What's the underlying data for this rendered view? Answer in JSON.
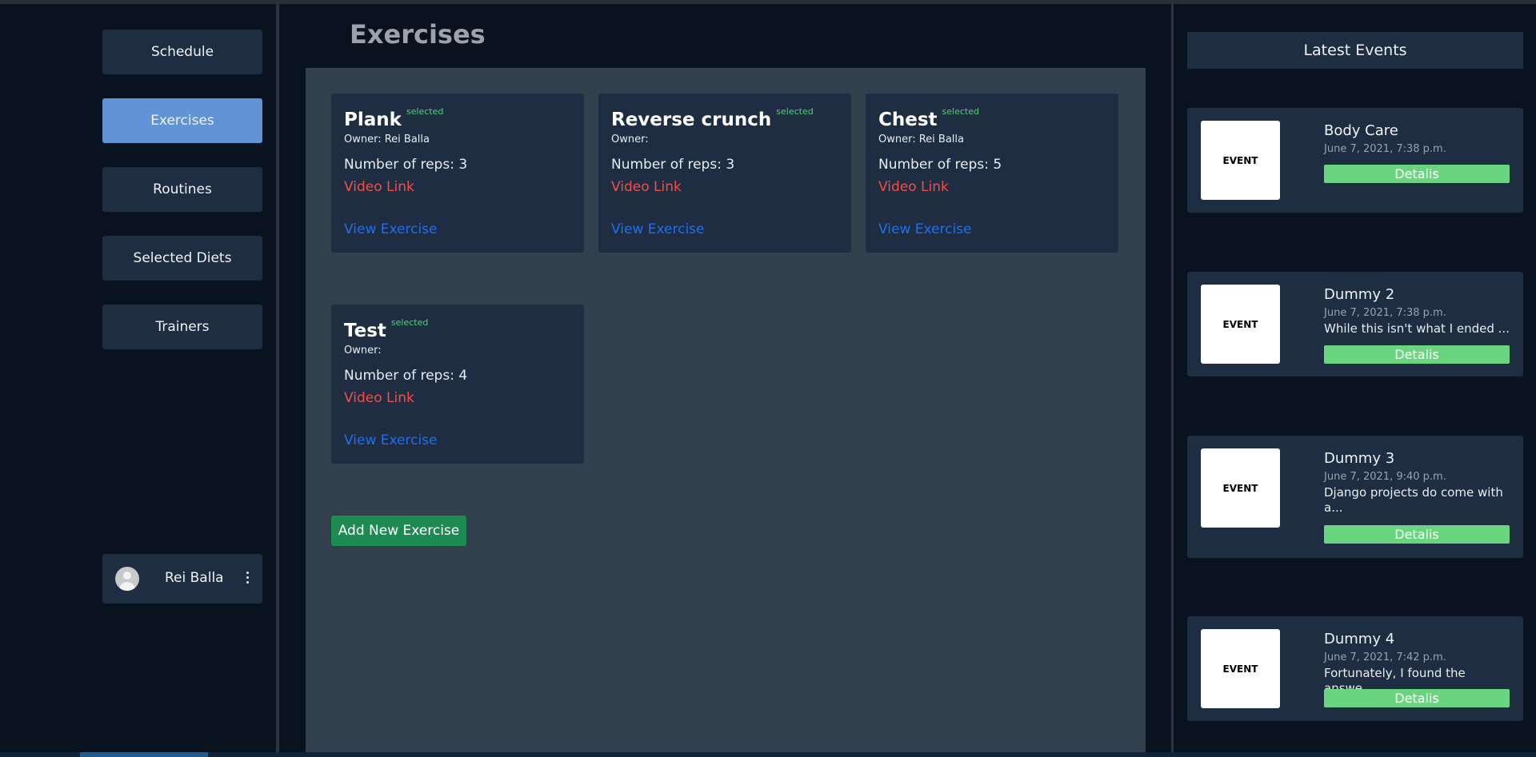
{
  "nav": {
    "items": [
      {
        "label": "Schedule"
      },
      {
        "label": "Exercises"
      },
      {
        "label": "Routines"
      },
      {
        "label": "Selected Diets"
      },
      {
        "label": "Trainers"
      }
    ],
    "active": "Exercises"
  },
  "user": {
    "name": "Rei Balla"
  },
  "main": {
    "title": "Exercises",
    "exercises": [
      {
        "name": "Plank",
        "badge": "selected",
        "owner": "Owner: Rei Balla",
        "reps": "Number of reps: 3",
        "video_link": "Video Link",
        "view_link": "View Exercise"
      },
      {
        "name": "Reverse crunch",
        "badge": "selected",
        "owner": "Owner:",
        "reps": "Number of reps: 3",
        "video_link": "Video Link",
        "view_link": "View Exercise"
      },
      {
        "name": "Chest",
        "badge": "selected",
        "owner": "Owner: Rei Balla",
        "reps": "Number of reps: 5",
        "video_link": "Video Link",
        "view_link": "View Exercise"
      },
      {
        "name": "Test",
        "badge": "selected",
        "owner": "Owner:",
        "reps": "Number of reps: 4",
        "video_link": "Video Link",
        "view_link": "View Exercise"
      }
    ],
    "add_button": "Add New Exercise"
  },
  "events": {
    "header": "Latest Events",
    "items": [
      {
        "thumb": "EVENT",
        "title": "Body Care",
        "date": "June 7, 2021, 7:38 p.m.",
        "desc": "",
        "button": "Detalis"
      },
      {
        "thumb": "EVENT",
        "title": "Dummy 2",
        "date": "June 7, 2021, 7:38 p.m.",
        "desc": "While this isn't what I ended ...",
        "button": "Detalis"
      },
      {
        "thumb": "EVENT",
        "title": "Dummy 3",
        "date": "June 7, 2021, 9:40 p.m.",
        "desc": "Django projects do come with a...",
        "button": "Detalis"
      },
      {
        "thumb": "EVENT",
        "title": "Dummy 4",
        "date": "June 7, 2021, 7:42 p.m.",
        "desc": "Fortunately, I found the answe...",
        "button": "Detalis"
      }
    ]
  },
  "colors": {
    "background": "#09131f",
    "panel": "#1e2d42",
    "main_panel": "#323f4d",
    "nav_active": "#6193d6",
    "badge_green": "#4ed07a",
    "video_link_red": "#f0504a",
    "view_link_blue": "#1f6ff0",
    "add_button_green": "#1d8a52",
    "details_button_green": "#69d57e"
  }
}
